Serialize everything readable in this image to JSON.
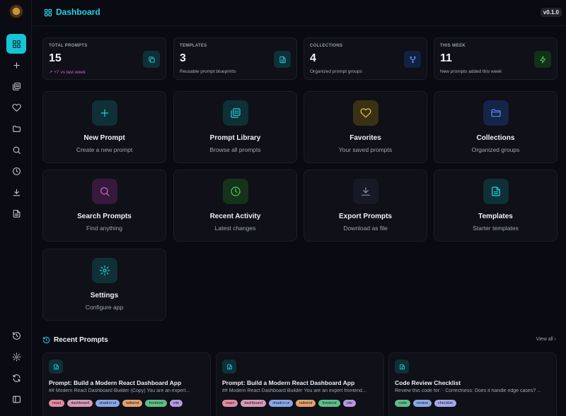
{
  "header": {
    "title": "Dashboard",
    "version": "v0.1.0"
  },
  "sidebar": {
    "items": [
      {
        "name": "dashboard",
        "icon": "grid-icon",
        "active": true
      },
      {
        "name": "new-prompt",
        "icon": "plus-icon"
      },
      {
        "name": "library",
        "icon": "library-icon"
      },
      {
        "name": "favorites",
        "icon": "heart-icon"
      },
      {
        "name": "collections",
        "icon": "folder-icon"
      },
      {
        "name": "search",
        "icon": "search-icon"
      },
      {
        "name": "recent",
        "icon": "clock-icon"
      },
      {
        "name": "export",
        "icon": "download-icon"
      },
      {
        "name": "templates",
        "icon": "file-icon"
      }
    ],
    "bottom": [
      {
        "name": "history",
        "icon": "history-icon"
      },
      {
        "name": "settings",
        "icon": "gear-icon"
      },
      {
        "name": "sync",
        "icon": "refresh-icon"
      },
      {
        "name": "collapse",
        "icon": "panel-icon"
      }
    ]
  },
  "stats": [
    {
      "label": "TOTAL PROMPTS",
      "value": "15",
      "sub": "+7 vs last week",
      "icon": "copy-icon",
      "color": "#22d3e6",
      "bg": "#0f3036"
    },
    {
      "label": "TEMPLATES",
      "value": "3",
      "sub": "Reusable prompt blueprints",
      "icon": "file-icon",
      "color": "#22d3e6",
      "bg": "#0f3036"
    },
    {
      "label": "COLLECTIONS",
      "value": "4",
      "sub": "Organized prompt groups",
      "icon": "fork-icon",
      "color": "#5b8cff",
      "bg": "#12213f"
    },
    {
      "label": "THIS WEEK",
      "value": "11",
      "sub": "New prompts added this week",
      "icon": "bolt-icon",
      "color": "#43d35a",
      "bg": "#133019"
    }
  ],
  "actions": [
    {
      "title": "New Prompt",
      "sub": "Create a new prompt",
      "icon": "plus-icon",
      "color": "#22d3e6",
      "bg": "#0f3036"
    },
    {
      "title": "Prompt Library",
      "sub": "Browse all prompts",
      "icon": "library-icon",
      "color": "#22d3e6",
      "bg": "#0f3036"
    },
    {
      "title": "Favorites",
      "sub": "Your saved prompts",
      "icon": "heart-icon",
      "color": "#f5c542",
      "bg": "#3a3114"
    },
    {
      "title": "Collections",
      "sub": "Organized groups",
      "icon": "folder-icon",
      "color": "#5b8cff",
      "bg": "#162447"
    },
    {
      "title": "Search Prompts",
      "sub": "Find anything",
      "icon": "search-icon",
      "color": "#d86be0",
      "bg": "#36193b"
    },
    {
      "title": "Recent Activity",
      "sub": "Latest changes",
      "icon": "clock-icon",
      "color": "#43d35a",
      "bg": "#16321b"
    },
    {
      "title": "Export Prompts",
      "sub": "Download as file",
      "icon": "download-icon",
      "color": "#8b90a0",
      "bg": "#171a26"
    },
    {
      "title": "Templates",
      "sub": "Starter templates",
      "icon": "file-icon",
      "color": "#22d3e6",
      "bg": "#0f3036"
    },
    {
      "title": "Settings",
      "sub": "Configure app",
      "icon": "gear-icon",
      "color": "#22d3e6",
      "bg": "#0f3036"
    }
  ],
  "recent": {
    "title": "Recent Prompts",
    "view_all": "View all",
    "items": [
      {
        "title": "Prompt: Build a Modern React Dashboard App",
        "desc": "## Modern React Dashboard Builder (Copy) You are an expert...",
        "tags": [
          "react",
          "dashboard",
          "shadcn-ui",
          "tailwind",
          "frontend",
          "vite"
        ]
      },
      {
        "title": "Prompt: Build a Modern React Dashboard App",
        "desc": "## Modern React Dashboard Builder You are an expert frontend...",
        "tags": [
          "react",
          "dashboard",
          "shadcn-ui",
          "tailwind",
          "frontend",
          "vite"
        ]
      },
      {
        "title": "Code Review Checklist",
        "desc": "Review this code for: - Correctness: Does it handle edge cases? ...",
        "tags": [
          "code",
          "review",
          "checklist"
        ]
      }
    ]
  },
  "tag_colors": {
    "react": "#e58aa0",
    "dashboard": "#d99ab8",
    "shadcn-ui": "#8aa8e8",
    "tailwind": "#e3a36c",
    "frontend": "#5fc08a",
    "vite": "#b59ae3",
    "code": "#5fc08a",
    "review": "#8aa8e8",
    "checklist": "#a3a8e8"
  }
}
